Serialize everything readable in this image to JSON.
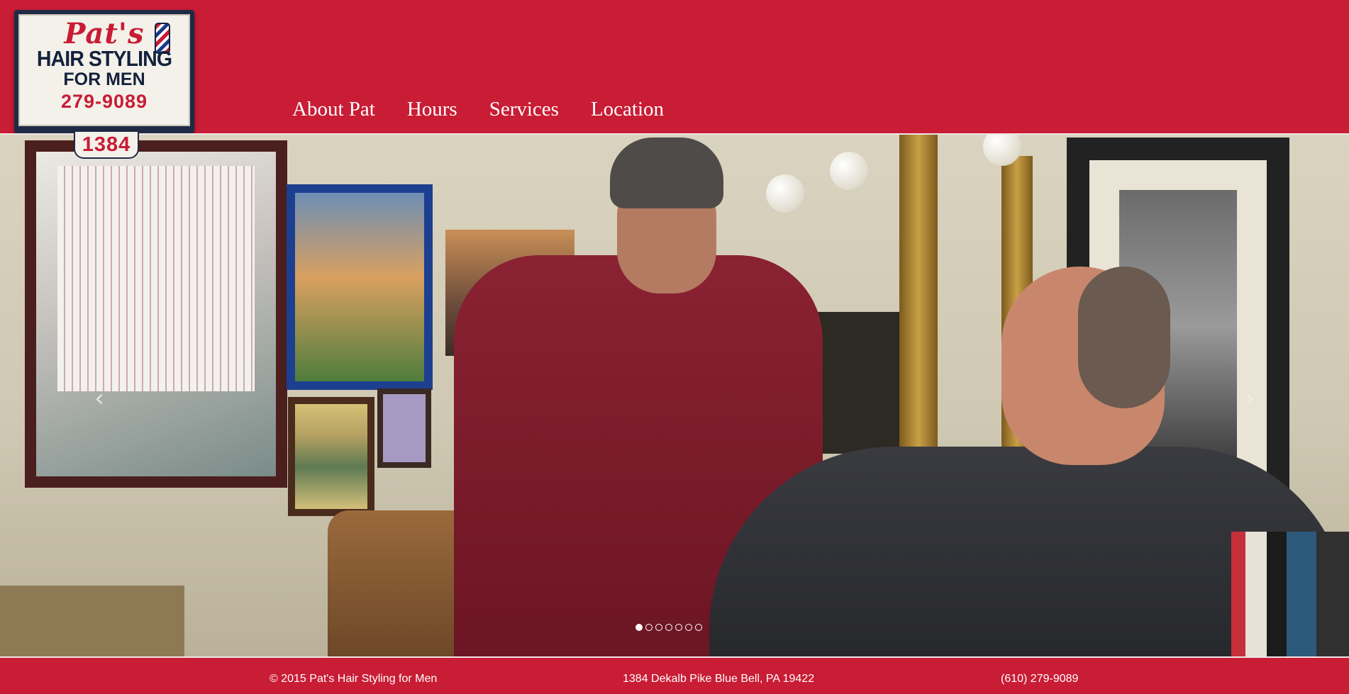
{
  "logo": {
    "script": "Pat's",
    "line1": "HAIR STYLING",
    "line2": "FOR MEN",
    "phone": "279-9089",
    "number": "1384",
    "pole_icon": "barber-pole-icon"
  },
  "nav": {
    "items": [
      {
        "label": "About Pat"
      },
      {
        "label": "Hours"
      },
      {
        "label": "Services"
      },
      {
        "label": "Location"
      }
    ]
  },
  "carousel": {
    "prev_icon": "chevron-left-icon",
    "next_icon": "chevron-right-icon",
    "prev_glyph": "‹",
    "next_glyph": "›",
    "slide_count": 7,
    "active_slide": 1
  },
  "footer": {
    "copyright": "© 2015 Pat's Hair Styling for Men",
    "address": "1384 Dekalb Pike Blue Bell, PA 19422",
    "phone": "(610) 279-9089"
  },
  "colors": {
    "brand_red": "#c91c35",
    "navy": "#1f2a44",
    "white": "#ffffff"
  }
}
